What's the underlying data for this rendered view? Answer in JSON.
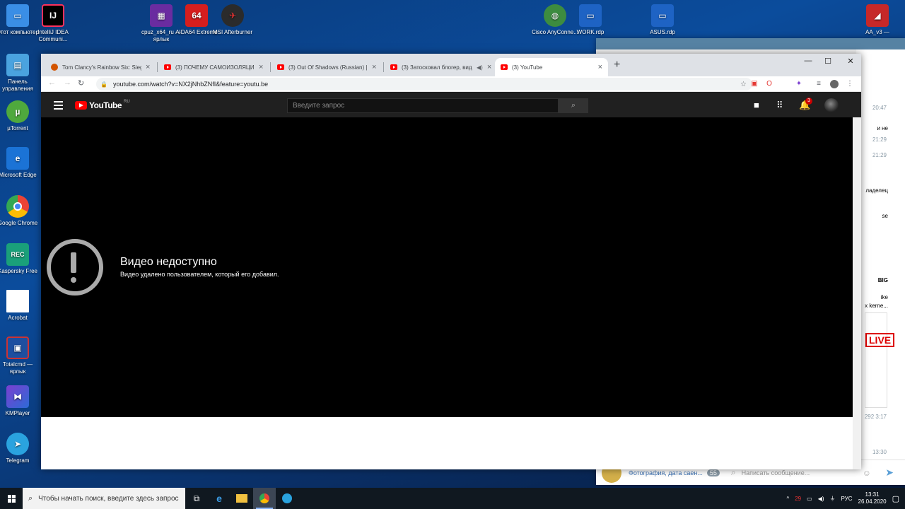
{
  "desktop": {
    "icons": [
      {
        "label": "Этот компьютер"
      },
      {
        "label": "IntelliJ IDEA Communi..."
      },
      {
        "label": "cpuz_x64_ru — ярлык"
      },
      {
        "label": "AIDA64 Extreme"
      },
      {
        "label": "MSI Afterburner"
      },
      {
        "label": "Cisco AnyConne..."
      },
      {
        "label": "WORK.rdp"
      },
      {
        "label": "ASUS.rdp"
      },
      {
        "label": "AA_v3 —"
      },
      {
        "label": "Панель управления"
      },
      {
        "label": "µTorrent"
      },
      {
        "label": "Microsoft Edge"
      },
      {
        "label": "Google Chrome"
      },
      {
        "label": "Kaspersky Free"
      },
      {
        "label": "Acrobat"
      },
      {
        "label": "Totalcmd — ярлык"
      },
      {
        "label": "KMPlayer"
      },
      {
        "label": "Telegram"
      }
    ]
  },
  "telegram": {
    "messages": [
      "и не",
      "ладелец",
      "se",
      "BIG",
      "ike",
      "x kerne..."
    ],
    "times": [
      "20:47",
      "21:29",
      "21:29",
      "292",
      "3:17",
      "13:30"
    ],
    "badge": "LIVE",
    "footer_chat": "Фотография, дата саен...",
    "footer_count": "55",
    "input_placeholder": "Написать сообщение..."
  },
  "browser": {
    "tabs": [
      {
        "title": "Tom Clancy's Rainbow Six: Siege",
        "icon": "steam-favicon"
      },
      {
        "title": "(3) ПОЧЕМУ САМОИЗОЛЯЦИИ",
        "icon": "youtube-favicon"
      },
      {
        "title": "(3) Out Of Shadows (Russian) | И",
        "icon": "youtube-favicon"
      },
      {
        "title": "(3) Затосковал блогер, вид",
        "icon": "youtube-favicon"
      },
      {
        "title": "(3) YouTube",
        "icon": "youtube-favicon",
        "active": true
      }
    ],
    "url": "youtube.com/watch?v=NX2jNhbZNfI&feature=youtu.be"
  },
  "youtube": {
    "logo_text": "YouTube",
    "logo_region": "RU",
    "search_placeholder": "Введите запрос",
    "notifications_count": "3",
    "error_title": "Видео недоступно",
    "error_subtitle": "Видео удалено пользователем, который его добавил."
  },
  "taskbar": {
    "search_placeholder": "Чтобы начать поиск, введите здесь запрос",
    "language": "РУС",
    "time": "13:31",
    "date": "26.04.2020",
    "tray_temp": "29"
  }
}
